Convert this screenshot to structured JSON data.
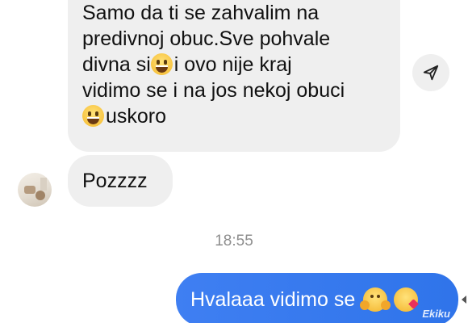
{
  "messages": {
    "incoming_long": {
      "lines": [
        "Samo da ti se zahvalim na",
        "predivnoj obuc.Sve pohvale",
        "divna si",
        "i ovo nije kraj",
        "vidimo se i na jos nekoj obuci",
        "uskoro"
      ]
    },
    "incoming_short": {
      "text": "Pozzzz"
    },
    "timestamp": "18:55",
    "outgoing": {
      "text": "Hvalaaa vidimo se"
    }
  },
  "icons": {
    "send": "send-icon",
    "smile": "grinning-face-emoji",
    "hug": "hugging-face-emoji",
    "kiss": "face-blowing-kiss-emoji"
  },
  "watermark": "Ekiku",
  "colors": {
    "incoming_bubble": "#efefef",
    "outgoing_bubble": "#3b82f6",
    "timestamp": "#8e8e8e"
  }
}
